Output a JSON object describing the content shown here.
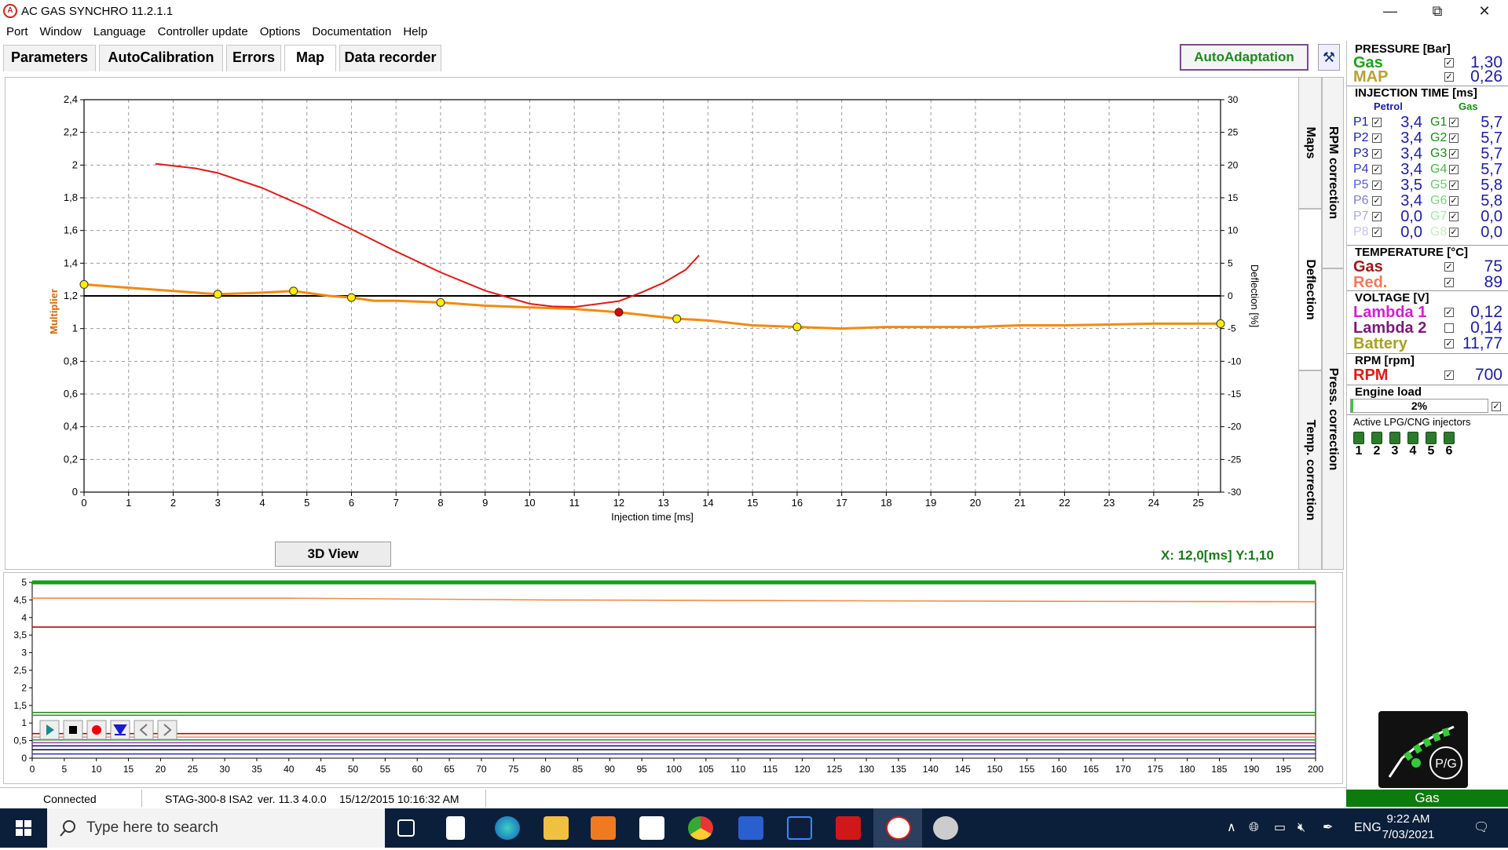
{
  "window": {
    "title": "AC GAS SYNCHRO  11.2.1.1",
    "controls": [
      "—",
      "⧉",
      "✕"
    ]
  },
  "menu": [
    "Port",
    "Window",
    "Language",
    "Controller update",
    "Options",
    "Documentation",
    "Help"
  ],
  "tabs": [
    {
      "label": "Parameters",
      "active": false
    },
    {
      "label": "AutoCalibration",
      "active": false
    },
    {
      "label": "Errors",
      "active": false
    },
    {
      "label": "Map",
      "active": true
    },
    {
      "label": "Data recorder",
      "active": false
    }
  ],
  "autoadaptation_label": "AutoAdaptation",
  "side_tabs": {
    "maps": "Maps",
    "deflection": "Deflection",
    "temp": "Temp. correction",
    "rpm": "RPM correction",
    "press": "Press. correction"
  },
  "view3d_label": "3D View",
  "xy_readout": "X: 12,0[ms] Y:1,10",
  "chart_data": {
    "type": "line",
    "xlabel": "Injection time [ms]",
    "ylabel_left": "Multiplier",
    "ylabel_right": "Deflection [%]",
    "xlim": [
      0,
      25.5
    ],
    "ylim_left": [
      0,
      2.4
    ],
    "ylim_right": [
      -30,
      30
    ],
    "x_ticks": [
      0,
      1,
      2,
      3,
      4,
      5,
      6,
      7,
      8,
      9,
      10,
      11,
      12,
      13,
      14,
      15,
      16,
      17,
      18,
      19,
      20,
      21,
      22,
      23,
      24,
      25
    ],
    "x_tick_labels": [
      "0",
      "1",
      "2",
      "3",
      "4",
      "5",
      "6",
      "7",
      "8",
      "9",
      "10",
      "11",
      "12",
      "13",
      "14",
      "15",
      "16",
      "17",
      "18",
      "19",
      "20",
      "21",
      "22",
      "23",
      "24",
      "25"
    ],
    "y_left_ticks": [
      0,
      0.2,
      0.4,
      0.6,
      0.8,
      1,
      1.2,
      1.4,
      1.6,
      1.8,
      2,
      2.2,
      2.4
    ],
    "y_left_tick_labels": [
      "0",
      "0,2",
      "0,4",
      "0,6",
      "0,8",
      "1",
      "1,2",
      "1,4",
      "1,6",
      "1,8",
      "2",
      "2,2",
      "2,4"
    ],
    "y_right_ticks": [
      -30,
      -25,
      -20,
      -15,
      -10,
      -5,
      0,
      5,
      10,
      15,
      20,
      25,
      30
    ],
    "y_right_tick_labels": [
      "-30",
      "-25",
      "-20",
      "-15",
      "-10",
      "-5",
      "0",
      "5",
      "10",
      "15",
      "20",
      "25",
      "30"
    ],
    "grid": true,
    "series": [
      {
        "axis": "left",
        "color": "#f28a0f",
        "x": [
          0,
          1,
          2,
          3,
          4,
          4.7,
          5.5,
          6,
          6.5,
          7,
          8,
          9,
          10,
          11,
          12,
          13,
          13.3,
          14,
          15,
          16,
          17,
          18,
          20,
          21,
          22,
          24,
          25.5
        ],
        "y": [
          1.27,
          1.25,
          1.23,
          1.21,
          1.22,
          1.23,
          1.2,
          1.19,
          1.17,
          1.17,
          1.16,
          1.14,
          1.13,
          1.12,
          1.1,
          1.07,
          1.06,
          1.05,
          1.02,
          1.01,
          1.0,
          1.01,
          1.01,
          1.02,
          1.02,
          1.03,
          1.03
        ]
      },
      {
        "axis": "right",
        "color": "#e01818",
        "x": [
          1.6,
          2.5,
          3,
          4,
          5,
          6,
          7,
          8,
          9,
          10,
          10.5,
          11,
          12,
          12.5,
          13,
          13.5,
          13.8
        ],
        "y": [
          20.2,
          19.5,
          18.8,
          16.5,
          13.5,
          10.2,
          6.8,
          3.6,
          0.8,
          -1.2,
          -1.6,
          -1.7,
          -0.8,
          0.5,
          2.0,
          4.0,
          6.2
        ]
      }
    ],
    "reference_line": {
      "axis": "right",
      "y": 0,
      "color": "#000000"
    },
    "markers": [
      {
        "x": 0,
        "y": 1.27,
        "color": "#ffee00"
      },
      {
        "x": 3,
        "y": 1.21,
        "color": "#ffee00"
      },
      {
        "x": 4.7,
        "y": 1.23,
        "color": "#ffee00"
      },
      {
        "x": 6,
        "y": 1.19,
        "color": "#ffee00"
      },
      {
        "x": 8,
        "y": 1.16,
        "color": "#ffee00"
      },
      {
        "x": 12,
        "y": 1.1,
        "color": "#e00000"
      },
      {
        "x": 13.3,
        "y": 1.06,
        "color": "#ffee00"
      },
      {
        "x": 16,
        "y": 1.01,
        "color": "#ffee00"
      },
      {
        "x": 25.5,
        "y": 1.03,
        "color": "#ffee00"
      }
    ]
  },
  "recorder_chart": {
    "type": "line",
    "xlim": [
      0,
      200
    ],
    "ylim": [
      0,
      5
    ],
    "x_ticks": [
      0,
      5,
      10,
      15,
      20,
      25,
      30,
      35,
      40,
      45,
      50,
      55,
      60,
      65,
      70,
      75,
      80,
      85,
      90,
      95,
      100,
      105,
      110,
      115,
      120,
      125,
      130,
      135,
      140,
      145,
      150,
      155,
      160,
      165,
      170,
      175,
      180,
      185,
      190,
      195,
      200
    ],
    "y_ticks": [
      0,
      0.5,
      1,
      1.5,
      2,
      2.5,
      3,
      3.5,
      4,
      4.5,
      5
    ],
    "y_tick_labels": [
      "0",
      "0,5",
      "1",
      "1,5",
      "2",
      "2,5",
      "3",
      "3,5",
      "4",
      "4,5",
      "5"
    ],
    "series": [
      {
        "color": "#12a012",
        "values": [
          5,
          5
        ]
      },
      {
        "color": "#f08a4a",
        "values": [
          4.55,
          4.55,
          4.5,
          4.48,
          4.46,
          4.45
        ]
      },
      {
        "color": "#a01010",
        "values": [
          3.73,
          3.73
        ]
      },
      {
        "color": "#1a8a1a",
        "values": [
          1.3,
          1.3
        ]
      },
      {
        "color": "#4f8a2a",
        "values": [
          1.22,
          1.22
        ]
      },
      {
        "color": "#a01010",
        "values": [
          0.7,
          0.7
        ]
      },
      {
        "color": "#e88a8a",
        "values": [
          0.6,
          0.6
        ]
      },
      {
        "color": "#1aa01a",
        "values": [
          0.52,
          0.52
        ]
      },
      {
        "color": "#b03ab0",
        "values": [
          0.44,
          0.44
        ]
      },
      {
        "color": "#1414a0",
        "values": [
          0.35,
          0.35
        ]
      },
      {
        "color": "#0a0a0a",
        "values": [
          0.24,
          0.24
        ]
      },
      {
        "color": "#2a2ad0",
        "values": [
          0.12,
          0.12
        ]
      }
    ],
    "controls": [
      "play",
      "stop",
      "record",
      "download",
      "prev",
      "next"
    ]
  },
  "status": {
    "connection": "Connected",
    "device": "STAG-300-8 ISA2",
    "version": "ver. 11.3  4.0.0",
    "datetime": "15/12/2015 10:16:32 AM"
  },
  "right_panel": {
    "pressure": {
      "title": "PRESSURE [Bar]",
      "items": [
        {
          "label": "Gas",
          "value": "1,30",
          "color": "#1ba01b",
          "checked": true
        },
        {
          "label": "MAP",
          "value": "0,26",
          "color": "#b8a034",
          "checked": true
        }
      ]
    },
    "injection": {
      "title": "INJECTION TIME [ms]",
      "petrol_header": "Petrol",
      "gas_header": "Gas",
      "rows": [
        {
          "p": "P1",
          "pv": "3,4",
          "g": "G1",
          "gv": "5,7",
          "pc": "#1c1ca0",
          "gc": "#1a8a1a",
          "pchk": true,
          "gchk": true
        },
        {
          "p": "P2",
          "pv": "3,4",
          "g": "G2",
          "gv": "5,7",
          "pc": "#1c1ca0",
          "gc": "#1a8a1a",
          "pchk": true,
          "gchk": true
        },
        {
          "p": "P3",
          "pv": "3,4",
          "g": "G3",
          "gv": "5,7",
          "pc": "#1c1ca0",
          "gc": "#1a8a1a",
          "pchk": true,
          "gchk": true
        },
        {
          "p": "P4",
          "pv": "3,4",
          "g": "G4",
          "gv": "5,7",
          "pc": "#3838c8",
          "gc": "#44b844",
          "pchk": true,
          "gchk": true
        },
        {
          "p": "P5",
          "pv": "3,5",
          "g": "G5",
          "gv": "5,8",
          "pc": "#5a5ad8",
          "gc": "#66cc66",
          "pchk": true,
          "gchk": true
        },
        {
          "p": "P6",
          "pv": "3,4",
          "g": "G6",
          "gv": "5,8",
          "pc": "#7a7ae0",
          "gc": "#7ed07e",
          "pchk": true,
          "gchk": true
        },
        {
          "p": "P7",
          "pv": "0,0",
          "g": "G7",
          "gv": "0,0",
          "pc": "#a8a8ee",
          "gc": "#a8e4a8",
          "pchk": true,
          "gchk": true
        },
        {
          "p": "P8",
          "pv": "0,0",
          "g": "G8",
          "gv": "0,0",
          "pc": "#c4c4f4",
          "gc": "#c4eec4",
          "pchk": true,
          "gchk": true
        }
      ]
    },
    "temperature": {
      "title": "TEMPERATURE [°C]",
      "items": [
        {
          "label": "Gas",
          "value": "75",
          "color": "#9a1a1a",
          "checked": true
        },
        {
          "label": "Red.",
          "value": "89",
          "color": "#f07a5a",
          "checked": true
        }
      ]
    },
    "voltage": {
      "title": "VOLTAGE [V]",
      "items": [
        {
          "label": "Lambda 1",
          "value": "0,12",
          "color": "#d020d0",
          "checked": true
        },
        {
          "label": "Lambda 2",
          "value": "0,14",
          "color": "#7a1a7a",
          "checked": false
        },
        {
          "label": "Battery",
          "value": "11,77",
          "color": "#a8a020",
          "checked": true
        }
      ]
    },
    "rpm": {
      "title": "RPM [rpm]",
      "label": "RPM",
      "value": "700",
      "color": "#e01818",
      "checked": true
    },
    "engine_load": {
      "title": "Engine load",
      "value": "2%",
      "fraction": 0.02,
      "checked": true
    },
    "active_injectors": {
      "title": "Active LPG/CNG injectors",
      "numbers": [
        "1",
        "2",
        "3",
        "4",
        "5",
        "6"
      ]
    },
    "logo_text": "P/G",
    "fuel_status": "Gas"
  },
  "taskbar": {
    "search_placeholder": "Type here to search",
    "language": "ENG",
    "time": "9:22 AM",
    "date": "7/03/2021"
  }
}
